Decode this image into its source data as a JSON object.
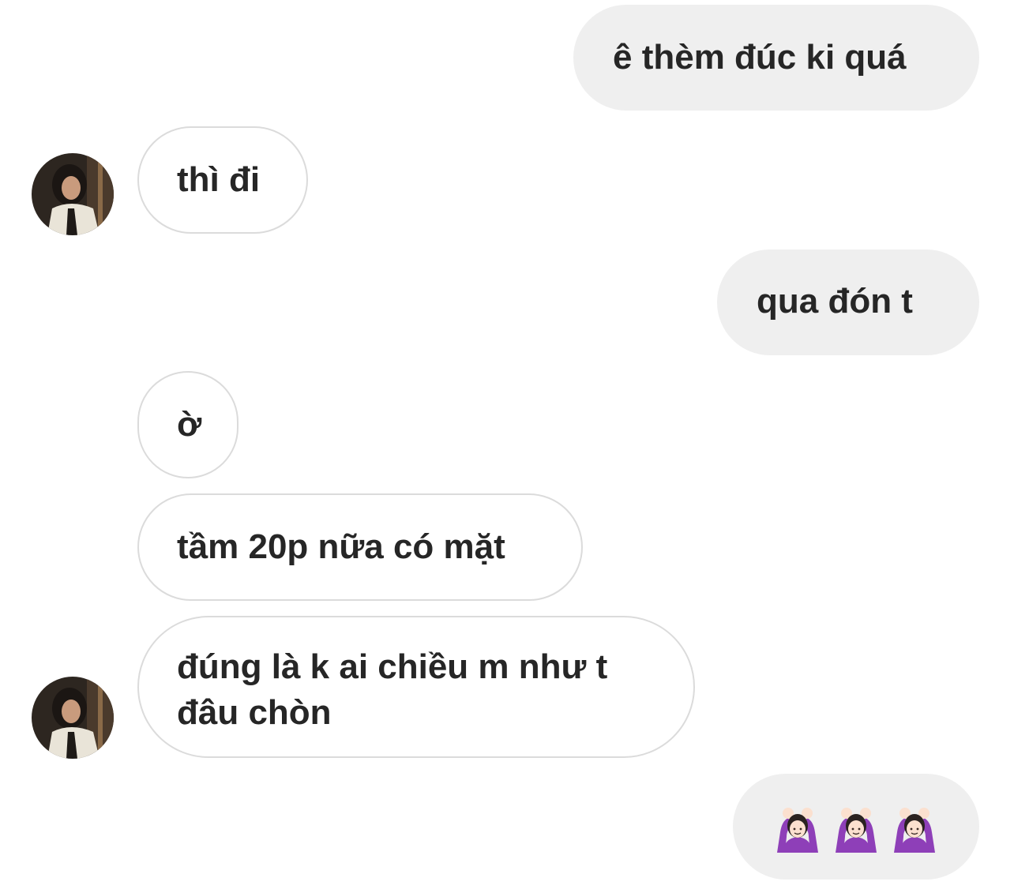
{
  "conversation": {
    "messages": [
      {
        "sender": "me",
        "text": "ê thèm đúc ki quá"
      },
      {
        "sender": "them",
        "text": "thì đi",
        "avatar": "contact-avatar"
      },
      {
        "sender": "me",
        "text": "qua đón t"
      },
      {
        "sender": "them",
        "text": "ờ"
      },
      {
        "sender": "them",
        "text": "tầm 20p nữa có mặt"
      },
      {
        "sender": "them",
        "text": "đúng là k ai chiều m như t đâu chòn",
        "avatar": "contact-avatar"
      },
      {
        "sender": "me",
        "emojis": [
          "person-gesturing-ok-emoji",
          "person-gesturing-ok-emoji",
          "person-gesturing-ok-emoji"
        ]
      }
    ]
  },
  "colors": {
    "outgoing_bubble": "#efefef",
    "incoming_border": "#dbdbdb",
    "text": "#262626",
    "emoji_purple": "#8e3fb8"
  }
}
